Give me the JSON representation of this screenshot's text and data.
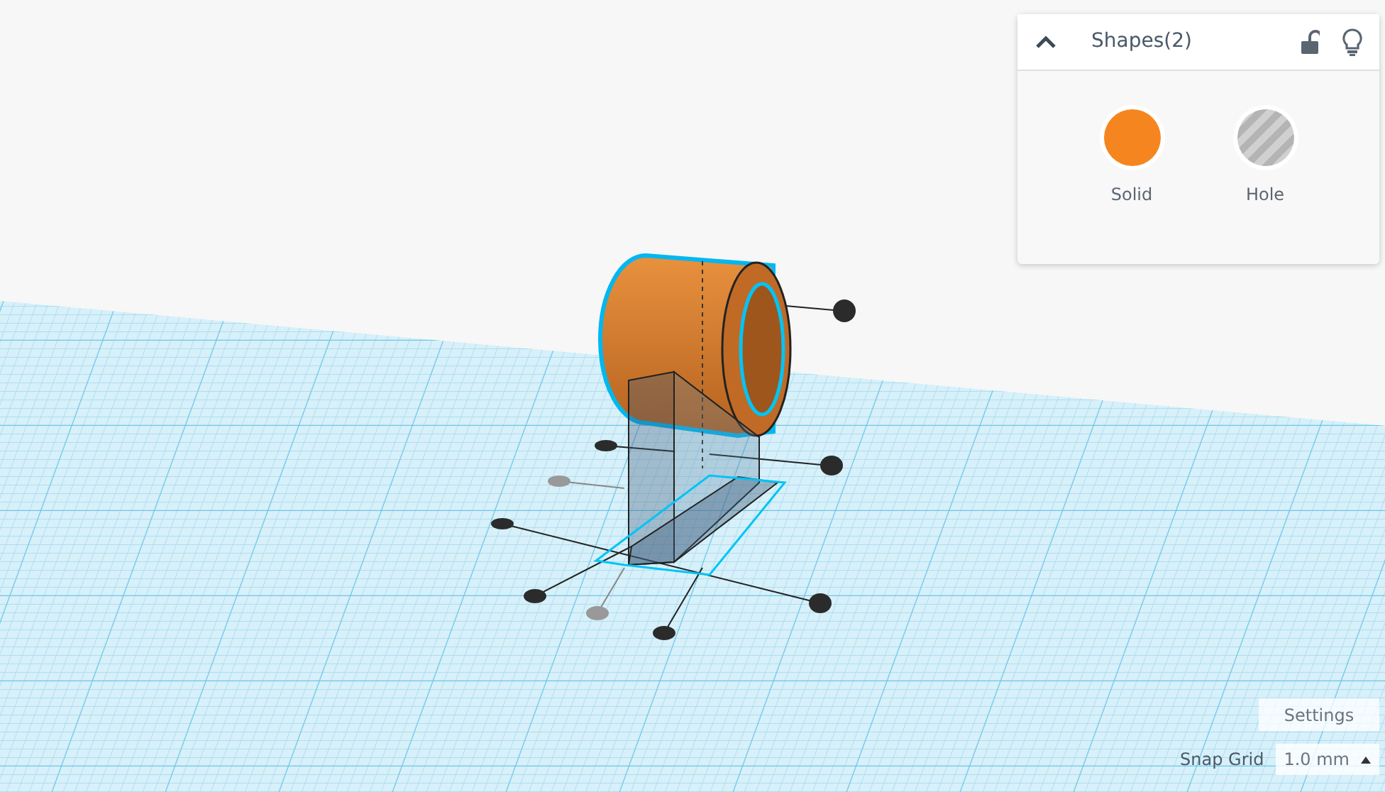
{
  "shape_panel": {
    "title": "Shapes(2)",
    "expanded": true,
    "locked": false,
    "options": [
      {
        "label": "Solid",
        "kind": "solid"
      },
      {
        "label": "Hole",
        "kind": "hole"
      }
    ]
  },
  "settings_button": "Settings",
  "snap_grid": {
    "label": "Snap Grid",
    "value": "1.0 mm"
  }
}
